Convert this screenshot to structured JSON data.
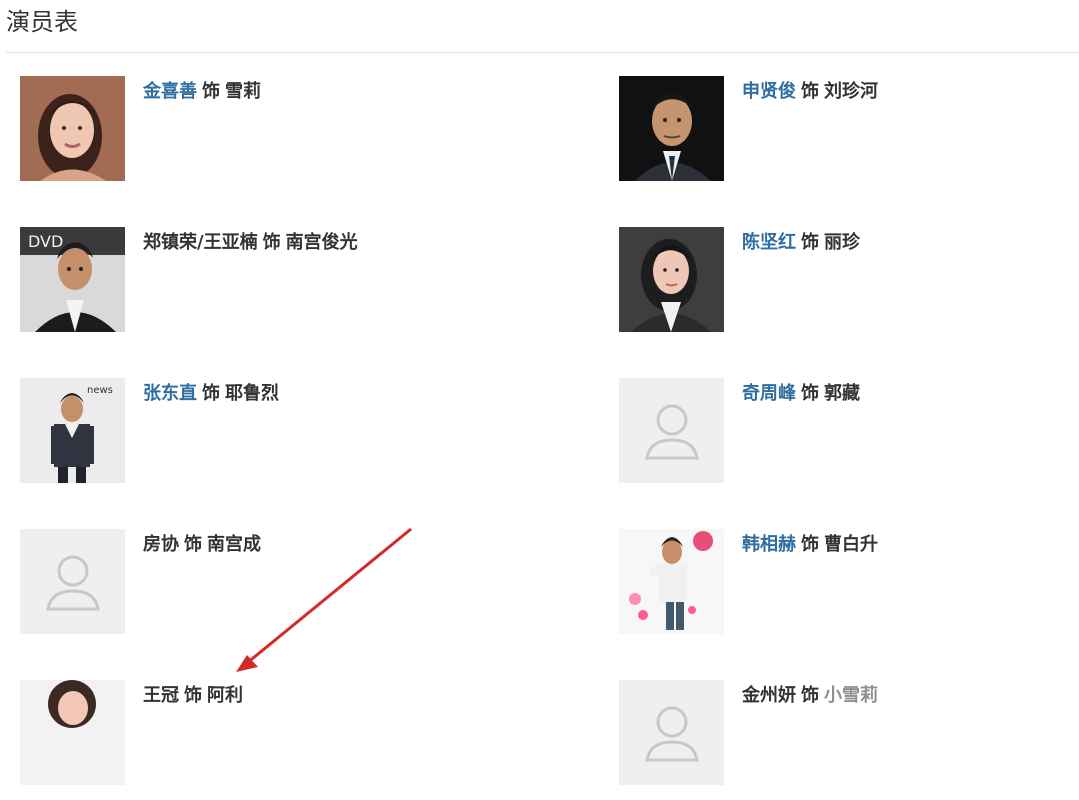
{
  "page": {
    "title": "演员表"
  },
  "cast": [
    {
      "actor": "金喜善",
      "as": "饰",
      "role": "雪莉",
      "actor_linked": true,
      "photo": "portrait-woman"
    },
    {
      "actor": "申贤俊",
      "as": "饰",
      "role": "刘珍河",
      "actor_linked": true,
      "photo": "portrait-man-suit"
    },
    {
      "actor": "郑镇荣/王亚楠",
      "as": "饰",
      "role": "南宫俊光",
      "actor_linked": false,
      "photo": "portrait-man-event"
    },
    {
      "actor": "陈坚红",
      "as": "饰",
      "role": "丽珍",
      "actor_linked": true,
      "photo": "portrait-woman-suit"
    },
    {
      "actor": "张东直",
      "as": "饰",
      "role": "耶鲁烈",
      "actor_linked": true,
      "photo": "portrait-man-standing"
    },
    {
      "actor": "奇周峰",
      "as": "饰",
      "role": "郭藏",
      "actor_linked": true,
      "photo": "placeholder-avatar"
    },
    {
      "actor": "房协",
      "as": "饰",
      "role": "南宫成",
      "actor_linked": false,
      "photo": "placeholder-avatar"
    },
    {
      "actor": "韩相赫",
      "as": "饰",
      "role": "曹白升",
      "actor_linked": true,
      "photo": "portrait-man-poster"
    },
    {
      "actor": "王冠",
      "as": "饰",
      "role": "阿利",
      "actor_linked": false,
      "photo": "portrait-woman-cropped"
    },
    {
      "actor": "金州妍",
      "as": "饰",
      "role": "小雪莉",
      "actor_linked": false,
      "photo": "placeholder-avatar"
    }
  ],
  "annotation": {
    "type": "red-arrow",
    "color": "#d42a2a"
  }
}
